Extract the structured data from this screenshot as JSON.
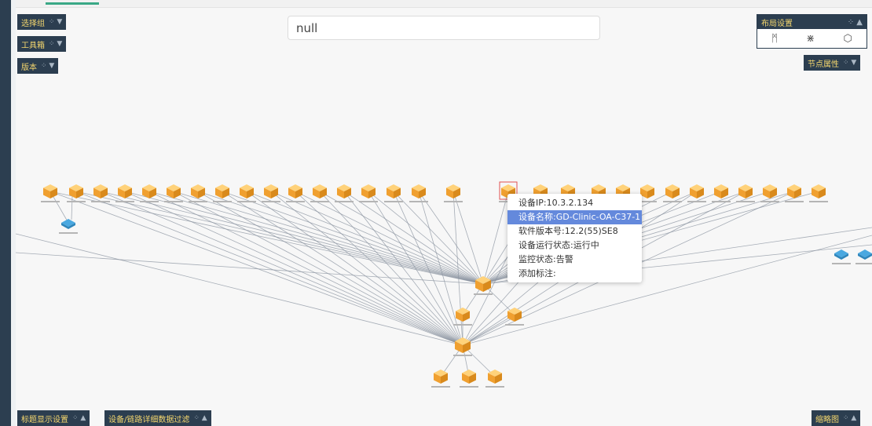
{
  "panels": {
    "select_group": "选择组",
    "toolbox": "工具箱",
    "version": "版本",
    "node_props": "节点属性",
    "label_settings": "标题显示设置",
    "data_filter": "设备/链路详细数据过滤",
    "minimap": "缩略图"
  },
  "search": {
    "value": "null"
  },
  "layout": {
    "title": "布局设置",
    "icons": [
      "hierarchy-layout-icon",
      "star-layout-icon",
      "circle-layout-icon"
    ]
  },
  "tooltip": {
    "rows": [
      "设备IP:10.3.2.134",
      "设备名称:GD-Clinic-OA-C37-1",
      "软件版本号:12.2(55)SE8",
      "设备运行状态:运行中",
      "监控状态:告警",
      "添加标注:"
    ],
    "active_index": 1
  },
  "colors": {
    "panel_bg": "#2c3e50",
    "panel_text": "#f5d76e",
    "device_orange": "#f0a030",
    "switch_blue": "#4aa8e0",
    "highlight": "#6489dc",
    "link": "#8a93a0"
  }
}
